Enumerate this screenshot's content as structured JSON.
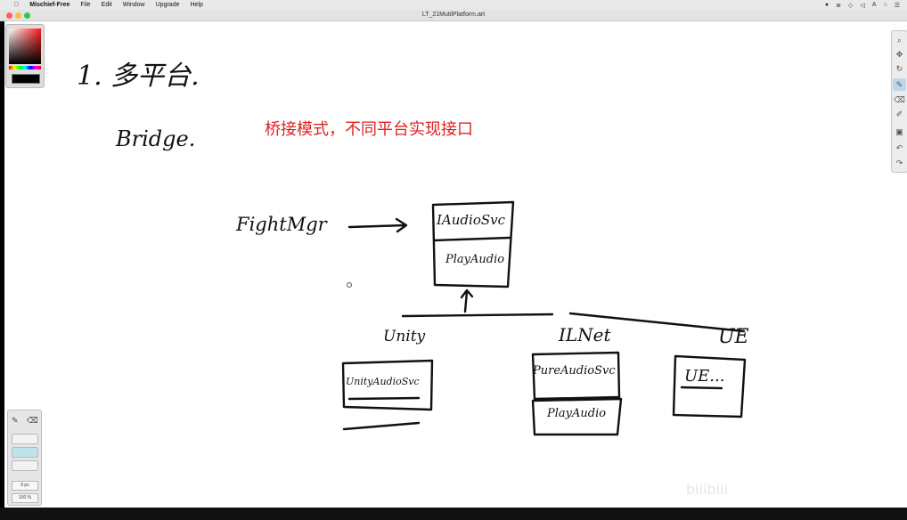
{
  "menubar": {
    "app_name": "Mischief-Free",
    "items": [
      "File",
      "Edit",
      "Window",
      "Upgrade",
      "Help"
    ]
  },
  "window": {
    "title": "LT_21MutilPlatform.art"
  },
  "canvas": {
    "heading": "1. 多平台.",
    "subheading": "Bridge.",
    "note": "桥接模式，不同平台实现接口",
    "diagram": {
      "client": "FightMgr",
      "interface_box": {
        "title": "IAudioSvc",
        "method": "PlayAudio"
      },
      "branches": [
        {
          "label": "Unity",
          "box_title": "UnityAudioSvc"
        },
        {
          "label": "ILNet",
          "box_title": "PureAudioSvc",
          "box_method": "PlayAudio"
        },
        {
          "label": "UE",
          "box_title": "UE..."
        }
      ]
    }
  },
  "brush_panel": {
    "size": "8 px",
    "opacity": "100 %"
  },
  "watermark": "bilibili",
  "colors": {
    "note": "#e02020",
    "ink": "#111111",
    "selected_tool": "#bcd6ea"
  }
}
